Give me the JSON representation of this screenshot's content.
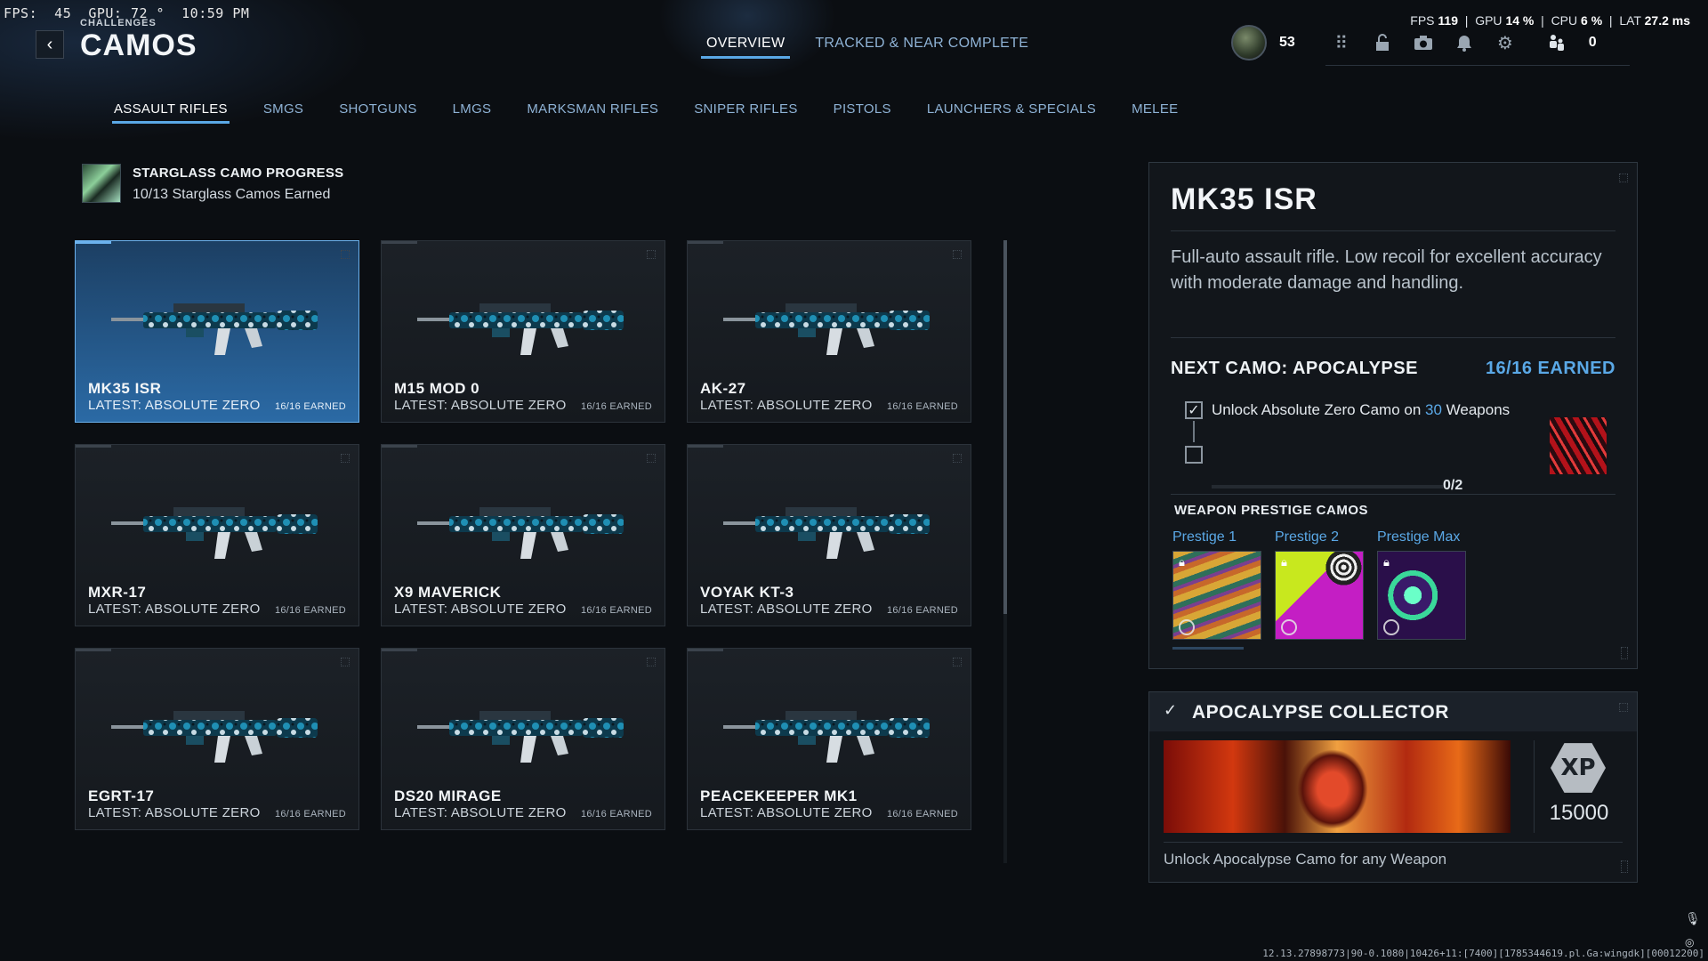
{
  "overlay": {
    "fps_left": "FPS:  45",
    "gpu_left": "GPU: 72 °",
    "clock": "10:59 PM",
    "perf_right": {
      "fps_label": "FPS",
      "fps": "119",
      "gpu_label": "GPU",
      "gpu": "14 %",
      "cpu_label": "CPU",
      "cpu": "6 %",
      "lat_label": "LAT",
      "lat": "27.2 ms"
    }
  },
  "header": {
    "breadcrumb": "CHALLENGES",
    "title": "CAMOS",
    "tabs": [
      {
        "label": "OVERVIEW",
        "active": true
      },
      {
        "label": "TRACKED & NEAR COMPLETE",
        "active": false
      }
    ],
    "player_level": "53",
    "count": "0",
    "icons": [
      "apps-icon",
      "lock-icon",
      "camera-icon",
      "bell-icon",
      "gear-icon",
      "party-icon"
    ]
  },
  "categories": [
    {
      "label": "ASSAULT RIFLES",
      "active": true
    },
    {
      "label": "SMGS"
    },
    {
      "label": "SHOTGUNS"
    },
    {
      "label": "LMGS"
    },
    {
      "label": "MARKSMAN RIFLES"
    },
    {
      "label": "SNIPER RIFLES"
    },
    {
      "label": "PISTOLS"
    },
    {
      "label": "LAUNCHERS & SPECIALS"
    },
    {
      "label": "MELEE"
    }
  ],
  "progress": {
    "title": "STARGLASS CAMO PROGRESS",
    "subtitle": "10/13 Starglass Camos Earned"
  },
  "weapons": [
    {
      "name": "MK35 ISR",
      "latest": "LATEST: ABSOLUTE ZERO",
      "earned": "16/16 EARNED",
      "selected": true
    },
    {
      "name": "M15 MOD 0",
      "latest": "LATEST: ABSOLUTE ZERO",
      "earned": "16/16 EARNED"
    },
    {
      "name": "AK-27",
      "latest": "LATEST: ABSOLUTE ZERO",
      "earned": "16/16 EARNED"
    },
    {
      "name": "MXR-17",
      "latest": "LATEST: ABSOLUTE ZERO",
      "earned": "16/16 EARNED"
    },
    {
      "name": "X9 MAVERICK",
      "latest": "LATEST: ABSOLUTE ZERO",
      "earned": "16/16 EARNED"
    },
    {
      "name": "VOYAK KT-3",
      "latest": "LATEST: ABSOLUTE ZERO",
      "earned": "16/16 EARNED"
    },
    {
      "name": "EGRT-17",
      "latest": "LATEST: ABSOLUTE ZERO",
      "earned": "16/16 EARNED"
    },
    {
      "name": "DS20 MIRAGE",
      "latest": "LATEST: ABSOLUTE ZERO",
      "earned": "16/16 EARNED"
    },
    {
      "name": "PEACEKEEPER MK1",
      "latest": "LATEST: ABSOLUTE ZERO",
      "earned": "16/16 EARNED"
    }
  ],
  "detail": {
    "title": "MK35 ISR",
    "description": "Full-auto assault rifle. Low recoil for excellent accuracy with moderate damage and handling.",
    "next_camo": "NEXT CAMO: APOCALYPSE",
    "next_earned": "16/16 EARNED",
    "challenge_pre": "Unlock Absolute Zero Camo on ",
    "challenge_num": "30",
    "challenge_post": " Weapons",
    "challenge_progress": "0/2",
    "prestige_heading": "WEAPON PRESTIGE CAMOS",
    "prestige": [
      {
        "label": "Prestige 1",
        "locked": true
      },
      {
        "label": "Prestige 2",
        "locked": true
      },
      {
        "label": "Prestige Max",
        "locked": true
      }
    ]
  },
  "collector": {
    "title": "APOCALYPSE COLLECTOR",
    "xp_badge": "XP",
    "xp": "15000",
    "description": "Unlock Apocalypse Camo for any Weapon"
  },
  "build_info": "12.13.27898773|90-0.1080|10426+11:[7400][1785344619.pl.Ga:wingdk][00012200]",
  "colors": {
    "accent": "#5aa8e6",
    "selected_card": "#2b6aa5",
    "background": "#0b0e12"
  }
}
